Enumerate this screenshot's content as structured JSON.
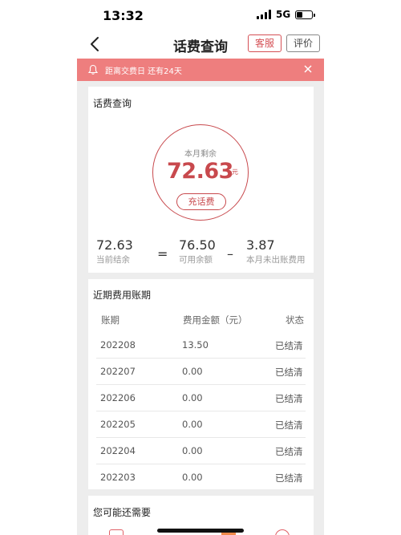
{
  "status_bar": {
    "time": "13:32",
    "network": "5G"
  },
  "nav": {
    "title": "话费查询",
    "service_label": "客服",
    "rate_label": "评价"
  },
  "notice": {
    "text": "距离交费日 还有24天"
  },
  "balance_card": {
    "title": "话费查询",
    "ring_label": "本月剩余",
    "amount": "72.63",
    "unit": "元",
    "recharge_label": "充话费",
    "current_balance": {
      "value": "72.63",
      "label": "当前结余"
    },
    "available": {
      "value": "76.50",
      "label": "可用余额"
    },
    "unbilled": {
      "value": "3.87",
      "label": "本月未出账费用"
    },
    "equals": "=",
    "minus": "–"
  },
  "history": {
    "title": "近期费用账期",
    "headers": [
      "账期",
      "费用金额（元）",
      "状态"
    ],
    "rows": [
      {
        "period": "202208",
        "amount": "13.50",
        "status": "已结清"
      },
      {
        "period": "202207",
        "amount": "0.00",
        "status": "已结清"
      },
      {
        "period": "202206",
        "amount": "0.00",
        "status": "已结清"
      },
      {
        "period": "202205",
        "amount": "0.00",
        "status": "已结清"
      },
      {
        "period": "202204",
        "amount": "0.00",
        "status": "已结清"
      },
      {
        "period": "202203",
        "amount": "0.00",
        "status": "已结清"
      }
    ]
  },
  "more": {
    "title": "您可能还需要"
  },
  "colors": {
    "accent": "#c8494d",
    "notice_bg": "#ee7e7e",
    "panel_bg": "#ededed"
  }
}
